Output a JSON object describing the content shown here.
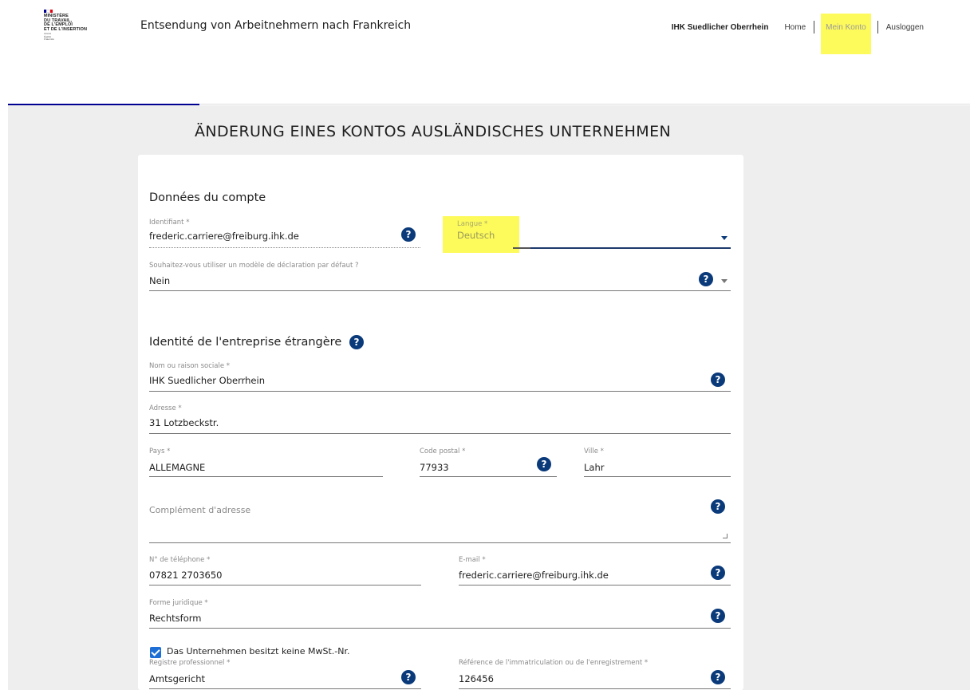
{
  "header": {
    "logo_lines": [
      "MINISTÈRE",
      "DU TRAVAIL,",
      "DE L'EMPLOI",
      "ET DE L'INSERTION"
    ],
    "logo_motto": [
      "Liberté",
      "Égalité",
      "Fraternité"
    ],
    "app_title": "Entsendung von Arbeitnehmern nach Frankreich",
    "nav": {
      "org": "IHK Suedlicher Oberrhein",
      "home": "Home",
      "account": "Mein Konto",
      "logout": "Ausloggen"
    }
  },
  "page_title": "ÄNDERUNG EINES KONTOS AUSLÄNDISCHES UNTERNEHMEN",
  "account_section": {
    "title": "Données du compte",
    "identifiant": {
      "label": "Identifiant *",
      "value": "frederic.carriere@freiburg.ihk.de"
    },
    "langue": {
      "label": "Langue *",
      "value": "Deutsch"
    },
    "modele": {
      "label": "Souhaitez-vous utiliser un modèle de déclaration par défaut ?",
      "value": "Nein"
    }
  },
  "company_section": {
    "title": "Identité de l'entreprise étrangère",
    "nom": {
      "label": "Nom ou raison sociale *",
      "value": "IHK Suedlicher Oberrhein"
    },
    "adresse": {
      "label": "Adresse *",
      "value": "31 Lotzbeckstr."
    },
    "pays": {
      "label": "Pays *",
      "value": "ALLEMAGNE"
    },
    "code_postal": {
      "label": "Code postal *",
      "value": "77933"
    },
    "ville": {
      "label": "Ville *",
      "value": "Lahr"
    },
    "complement": {
      "placeholder": "Complément d'adresse"
    },
    "telephone": {
      "label": "N° de téléphone *",
      "value": "07821 2703650"
    },
    "email": {
      "label": "E-mail *",
      "value": "frederic.carriere@freiburg.ihk.de"
    },
    "forme": {
      "label": "Forme juridique *",
      "value": "Rechtsform"
    },
    "no_vat_checkbox": {
      "label": "Das Unternehmen besitzt keine MwSt.-Nr.",
      "checked": true
    },
    "registre": {
      "label": "Registre professionnel *",
      "value": "Amtsgericht"
    },
    "reference": {
      "label": "Référence de l'immatriculation ou de l'enregistrement *",
      "value": "126456"
    }
  },
  "help_glyph": "?",
  "colors": {
    "accent": "#000091",
    "help": "#0a3a7a",
    "highlight": "#fdfa5c",
    "checkbox": "#1d6fd6",
    "page_bg": "#eeeeee"
  }
}
